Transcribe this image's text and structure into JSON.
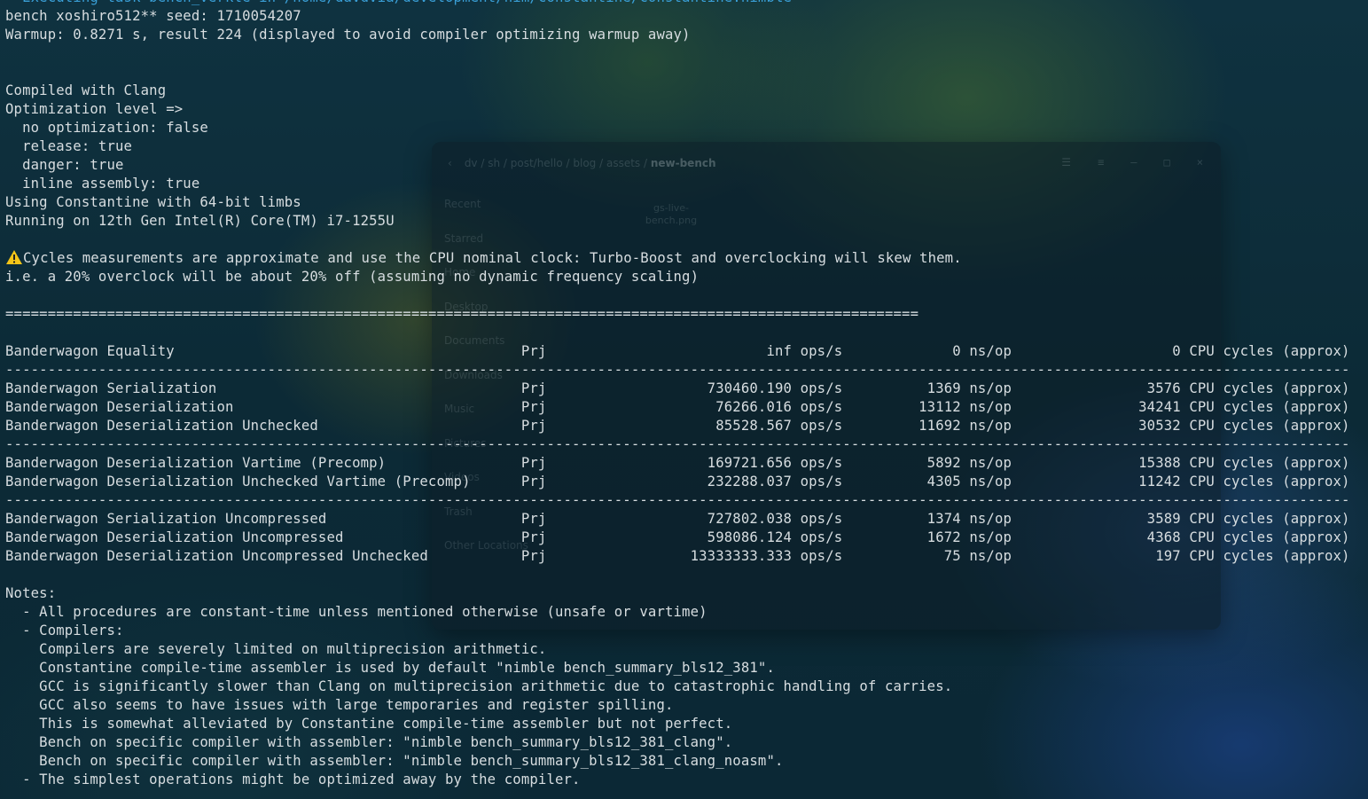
{
  "terminal": {
    "lines": [
      "  Executing task bench_verkle in /home/davdvia/development/nim/constantine/constantine.nimble",
      "bench xoshiro512** seed: 1710054207",
      "Warmup: 0.8271 s, result 224 (displayed to avoid compiler optimizing warmup away)",
      "",
      "",
      "Compiled with Clang",
      "Optimization level =>",
      "  no optimization: false",
      "  release: true",
      "  danger: true",
      "  inline assembly: true",
      "Using Constantine with 64-bit limbs",
      "Running on 12th Gen Intel(R) Core(TM) i7-1255U",
      "",
      "Cycles measurements are approximate and use the CPU nominal clock: Turbo-Boost and overclocking will skew them.",
      "i.e. a 20% overclock will be about 20% off (assuming no dynamic frequency scaling)",
      "",
      "============================================================================================================",
      "",
      "Banderwagon Equality                                         Prj                          inf ops/s             0 ns/op                   0 CPU cycles (approx)",
      "---------------------------------------------------------------------------------------------------------------------------------------------------------------",
      "Banderwagon Serialization                                    Prj                   730460.190 ops/s          1369 ns/op                3576 CPU cycles (approx)",
      "Banderwagon Deserialization                                  Prj                    76266.016 ops/s         13112 ns/op               34241 CPU cycles (approx)",
      "Banderwagon Deserialization Unchecked                        Prj                    85528.567 ops/s         11692 ns/op               30532 CPU cycles (approx)",
      "---------------------------------------------------------------------------------------------------------------------------------------------------------------",
      "Banderwagon Deserialization Vartime (Precomp)                Prj                   169721.656 ops/s          5892 ns/op               15388 CPU cycles (approx)",
      "Banderwagon Deserialization Unchecked Vartime (Precomp)      Prj                   232288.037 ops/s          4305 ns/op               11242 CPU cycles (approx)",
      "---------------------------------------------------------------------------------------------------------------------------------------------------------------",
      "Banderwagon Serialization Uncompressed                       Prj                   727802.038 ops/s          1374 ns/op                3589 CPU cycles (approx)",
      "Banderwagon Deserialization Uncompressed                     Prj                   598086.124 ops/s          1672 ns/op                4368 CPU cycles (approx)",
      "Banderwagon Deserialization Uncompressed Unchecked           Prj                 13333333.333 ops/s            75 ns/op                 197 CPU cycles (approx)",
      "",
      "Notes:",
      "  - All procedures are constant-time unless mentioned otherwise (unsafe or vartime)",
      "  - Compilers:",
      "    Compilers are severely limited on multiprecision arithmetic.",
      "    Constantine compile-time assembler is used by default \"nimble bench_summary_bls12_381\".",
      "    GCC is significantly slower than Clang on multiprecision arithmetic due to catastrophic handling of carries.",
      "    GCC also seems to have issues with large temporaries and register spilling.",
      "    This is somewhat alleviated by Constantine compile-time assembler but not perfect.",
      "    Bench on specific compiler with assembler: \"nimble bench_summary_bls12_381_clang\".",
      "    Bench on specific compiler with assembler: \"nimble bench_summary_bls12_381_clang_noasm\".",
      "  - The simplest operations might be optimized away by the compiler."
    ],
    "warning_icon": "warning-icon",
    "text_color": "#d7dde0",
    "accent_color": "#3aa0d8",
    "warning_color": "#f5c518"
  },
  "background_window": {
    "breadcrumbs": [
      "dv",
      "sh",
      "post/hello",
      "blog",
      "assets",
      "new-bench"
    ],
    "sidebar": [
      "Recent",
      "Starred",
      "Home",
      "Desktop",
      "Documents",
      "Downloads",
      "Music",
      "Pictures",
      "Videos",
      "Trash",
      "Other Locations"
    ],
    "file_name": "gs-live-bench.png"
  }
}
